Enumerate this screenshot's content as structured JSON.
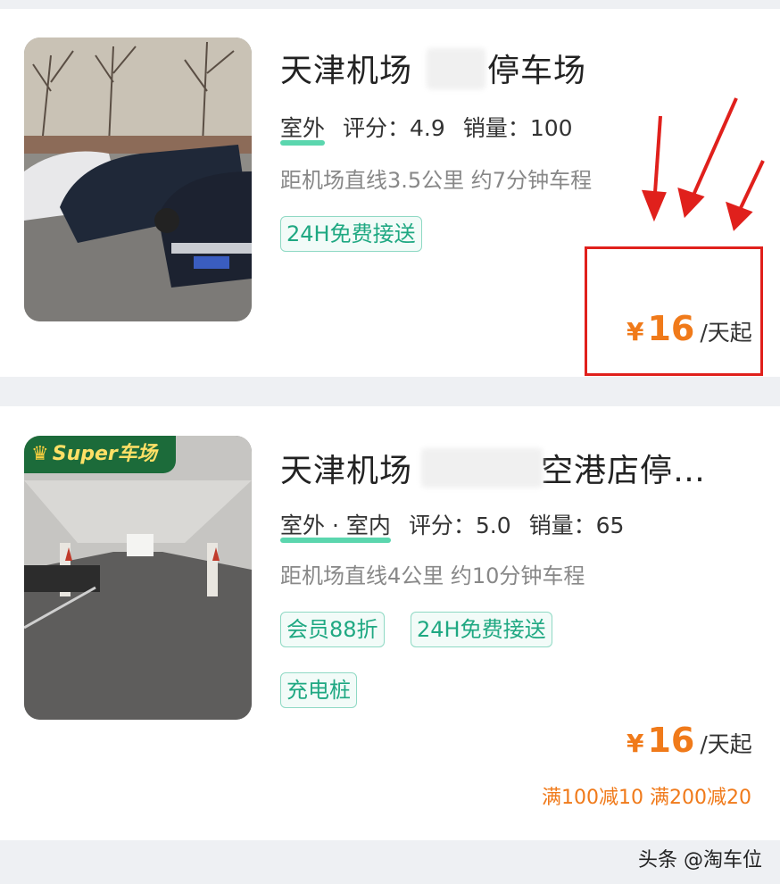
{
  "listings": [
    {
      "title": "天津机场",
      "title_suffix": "停车场",
      "type_tags": [
        "室外"
      ],
      "rating_label": "评分：",
      "rating": "4.9",
      "sales_label": "销量：",
      "sales": "100",
      "distance": "距机场直线3.5公里 约7分钟车程",
      "tags": [
        "24H免费接送"
      ],
      "price_currency": "¥",
      "price": "16",
      "price_unit": "/天起"
    },
    {
      "title": "天津机场",
      "title_suffix": "空港店停…",
      "badge": "Super车场",
      "type_tags": [
        "室外 · 室内"
      ],
      "rating_label": "评分：",
      "rating": "5.0",
      "sales_label": "销量：",
      "sales": "65",
      "distance": "距机场直线4公里 约10分钟车程",
      "tags": [
        "会员88折",
        "24H免费接送",
        "充电桩"
      ],
      "price_currency": "¥",
      "price": "16",
      "price_unit": "/天起",
      "promo": "满100减10 满200减20"
    }
  ],
  "watermark": "头条 @淘车位",
  "colors": {
    "accent_orange": "#f07a1a",
    "tag_green": "#1fa882",
    "annotation_red": "#e0201c"
  }
}
